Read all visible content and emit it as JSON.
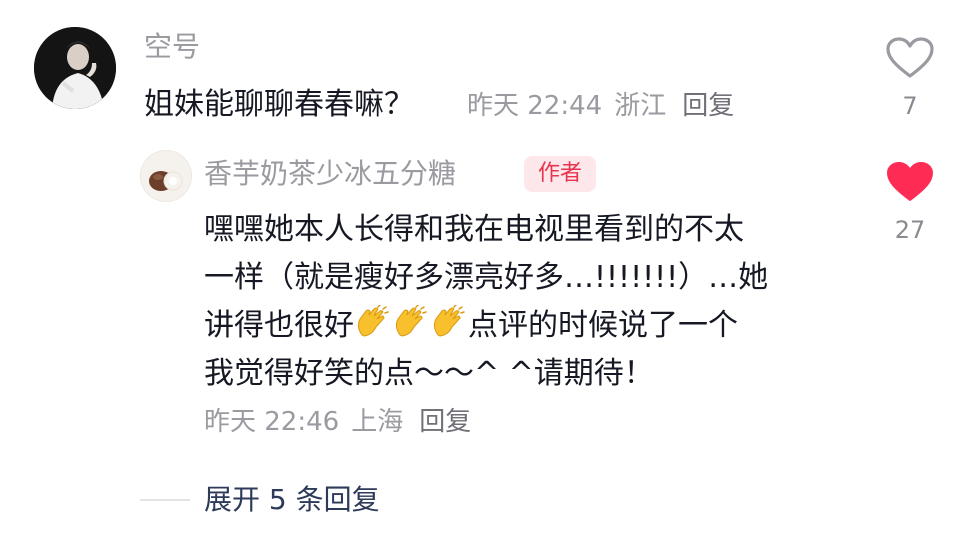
{
  "comment": {
    "avatar_icon": "user-avatar",
    "username": "空号",
    "text": "姐妹能聊聊春春嘛？",
    "time": "昨天 22:44",
    "location": "浙江",
    "reply_label": "回复",
    "like_count": "7",
    "liked": false,
    "like_icon": "heart-outline-icon",
    "colors": {
      "text": "#161823",
      "meta": "#9a9aa0",
      "icon_outline": "#9a9aa0"
    }
  },
  "reply": {
    "avatar_icon": "author-avatar",
    "username": "香芋奶茶少冰五分糖",
    "badge": "作者",
    "text_lines": [
      "嘿嘿她本人长得和我在电视里看到的不太",
      "一样（就是瘦好多漂亮好多…!!!!!!!）…她",
      "讲得也很好",
      "点评的时候说了一个",
      "我觉得好笑的点～～^ ^请期待！"
    ],
    "emoji": "👏👏👏",
    "time": "昨天 22:46",
    "location": "上海",
    "reply_label": "回复",
    "like_count": "27",
    "liked": true,
    "like_icon": "heart-filled-icon",
    "colors": {
      "badge_bg": "#fde7ea",
      "badge_text": "#e8344e",
      "like_active": "#fe2c55"
    }
  },
  "expand": {
    "label": "展开 5 条回复",
    "color": "#2d3a5a"
  }
}
